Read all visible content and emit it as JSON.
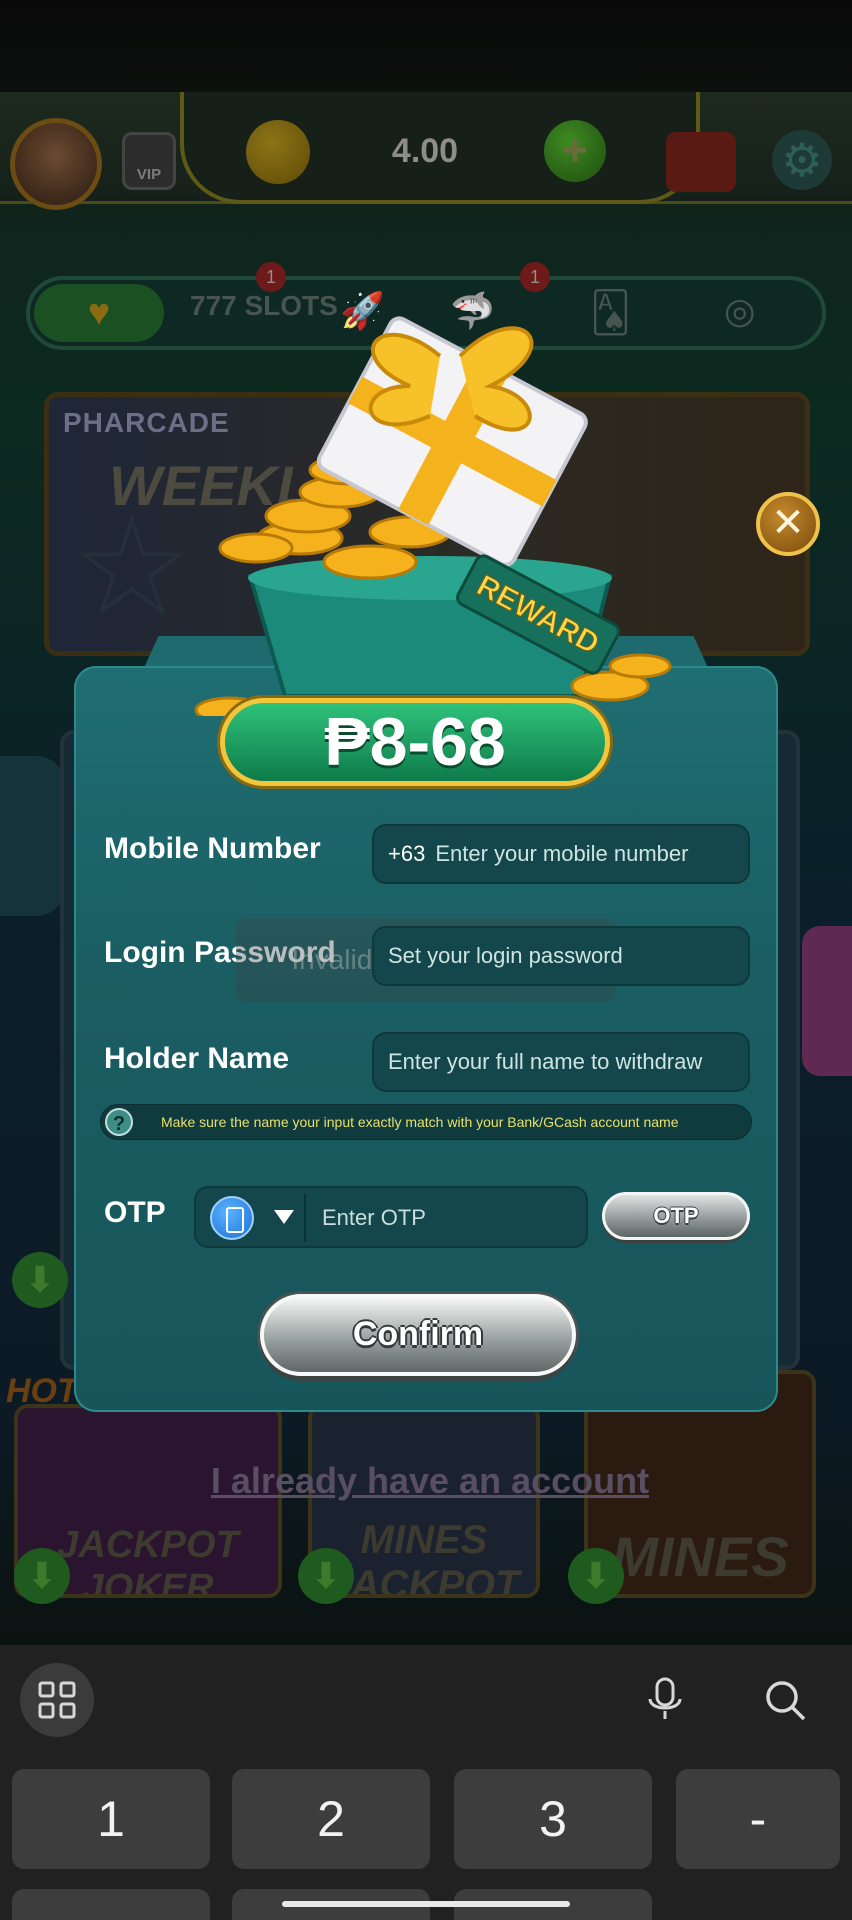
{
  "game": {
    "balance": "4.00",
    "vip_label": "VIP",
    "plus_label": "+",
    "categories": [
      {
        "label": "777\nSLOTS",
        "badge": "1"
      },
      {
        "label": "",
        "badge": "1"
      }
    ],
    "slots_label": "777 SLOTS",
    "banner_brand": "PHARCADE",
    "banner_title": "WEEKL MONT",
    "hot_label": "HOT",
    "tiles": [
      {
        "name": "JACKPOT JOKER"
      },
      {
        "name": "MINES JACKPOT"
      },
      {
        "name": "MINES"
      }
    ],
    "invalid_toast": "Invalid phone number",
    "already_account_link": "I already have an account"
  },
  "reward": {
    "tag": "REWARD",
    "amount": "₱8-68",
    "close_symbol": "✕"
  },
  "form": {
    "mobile": {
      "label": "Mobile Number",
      "prefix": "+63",
      "placeholder": "Enter your mobile number"
    },
    "password": {
      "label": "Login Password",
      "placeholder": "Set your login password"
    },
    "holder": {
      "label": "Holder Name",
      "placeholder": "Enter your full name to withdraw"
    },
    "notice": {
      "icon": "?",
      "text": "Make sure the name your input exactly match with your Bank/GCash account name"
    },
    "otp": {
      "label": "OTP",
      "placeholder": "Enter OTP",
      "button": "OTP"
    },
    "confirm": "Confirm"
  },
  "keyboard": {
    "keys": [
      "1",
      "2",
      "3",
      "-"
    ]
  },
  "colors": {
    "modal": "#1a5e63",
    "notice_text": "#e8e06a",
    "amount_green": "#1fa463",
    "gold": "#f2c53a"
  }
}
